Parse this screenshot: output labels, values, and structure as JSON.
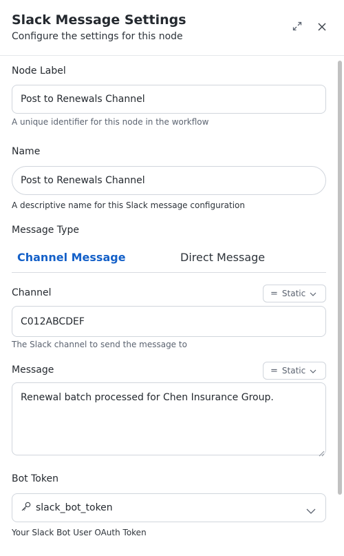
{
  "header": {
    "title": "Slack Message Settings",
    "subtitle": "Configure the settings for this node",
    "expand_icon": "expand-icon",
    "close_icon": "close-icon"
  },
  "node_label": {
    "label": "Node Label",
    "value": "Post to Renewals Channel",
    "help": "A unique identifier for this node in the workflow"
  },
  "name": {
    "label": "Name",
    "value": "Post to Renewals Channel",
    "help": "A descriptive name for this Slack message configuration"
  },
  "message_type": {
    "label": "Message Type",
    "tabs": [
      {
        "label": "Channel Message",
        "active": true
      },
      {
        "label": "Direct Message",
        "active": false
      }
    ],
    "active_color": "#1460c8"
  },
  "channel": {
    "label": "Channel",
    "mode": "Static",
    "value": "C012ABCDEF",
    "help": "The Slack channel to send the message to"
  },
  "message": {
    "label": "Message",
    "mode": "Static",
    "value": "Renewal batch processed for Chen Insurance Group."
  },
  "bot_token": {
    "label": "Bot Token",
    "icon": "key-icon",
    "value": "slack_bot_token",
    "help": "Your Slack Bot User OAuth Token"
  }
}
